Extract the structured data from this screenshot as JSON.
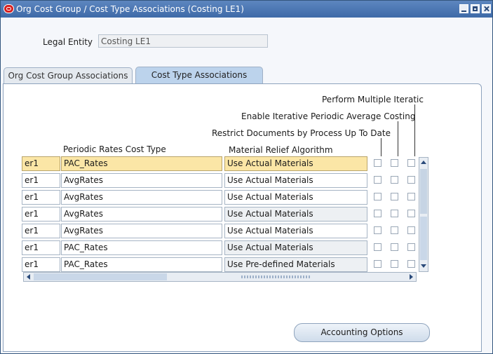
{
  "window": {
    "title": "Org Cost Group / Cost Type Associations (Costing LE1)"
  },
  "legal_entity": {
    "label": "Legal Entity",
    "value": "Costing LE1"
  },
  "tabs": [
    {
      "label": "Org Cost Group Associations",
      "active": false
    },
    {
      "label": "Cost Type Associations",
      "active": true
    }
  ],
  "table": {
    "headers": {
      "periodic_rates_cost_type": "Periodic Rates Cost Type",
      "material_relief_algorithm": "Material Relief Algorithm",
      "restrict_documents": "Restrict Documents by Process Up To Date",
      "enable_iterative": "Enable Iterative Periodic Average Costing",
      "perform_multiple": "Perform Multiple Iteratic"
    },
    "rows": [
      {
        "partial": "er1",
        "cost_type": "PAC_Rates",
        "algorithm": "Use Actual Materials",
        "selected": true
      },
      {
        "partial": "er1",
        "cost_type": "AvgRates",
        "algorithm": "Use Actual Materials",
        "selected": false
      },
      {
        "partial": "er1",
        "cost_type": "AvgRates",
        "algorithm": "Use Actual Materials",
        "selected": false
      },
      {
        "partial": "er1",
        "cost_type": "AvgRates",
        "algorithm": "Use Actual Materials",
        "selected": false
      },
      {
        "partial": "er1",
        "cost_type": "AvgRates",
        "algorithm": "Use Actual Materials",
        "selected": false
      },
      {
        "partial": "er1",
        "cost_type": "PAC_Rates",
        "algorithm": "Use Actual Materials",
        "selected": false
      },
      {
        "partial": "er1",
        "cost_type": "PAC_Rates",
        "algorithm": "Use Pre-defined Materials",
        "selected": false
      }
    ]
  },
  "buttons": {
    "accounting_options": "Accounting Options"
  },
  "colors": {
    "title_bar": "#3e6aa8",
    "selected_row": "#fbe6a6",
    "active_tab": "#bcd3ec"
  }
}
